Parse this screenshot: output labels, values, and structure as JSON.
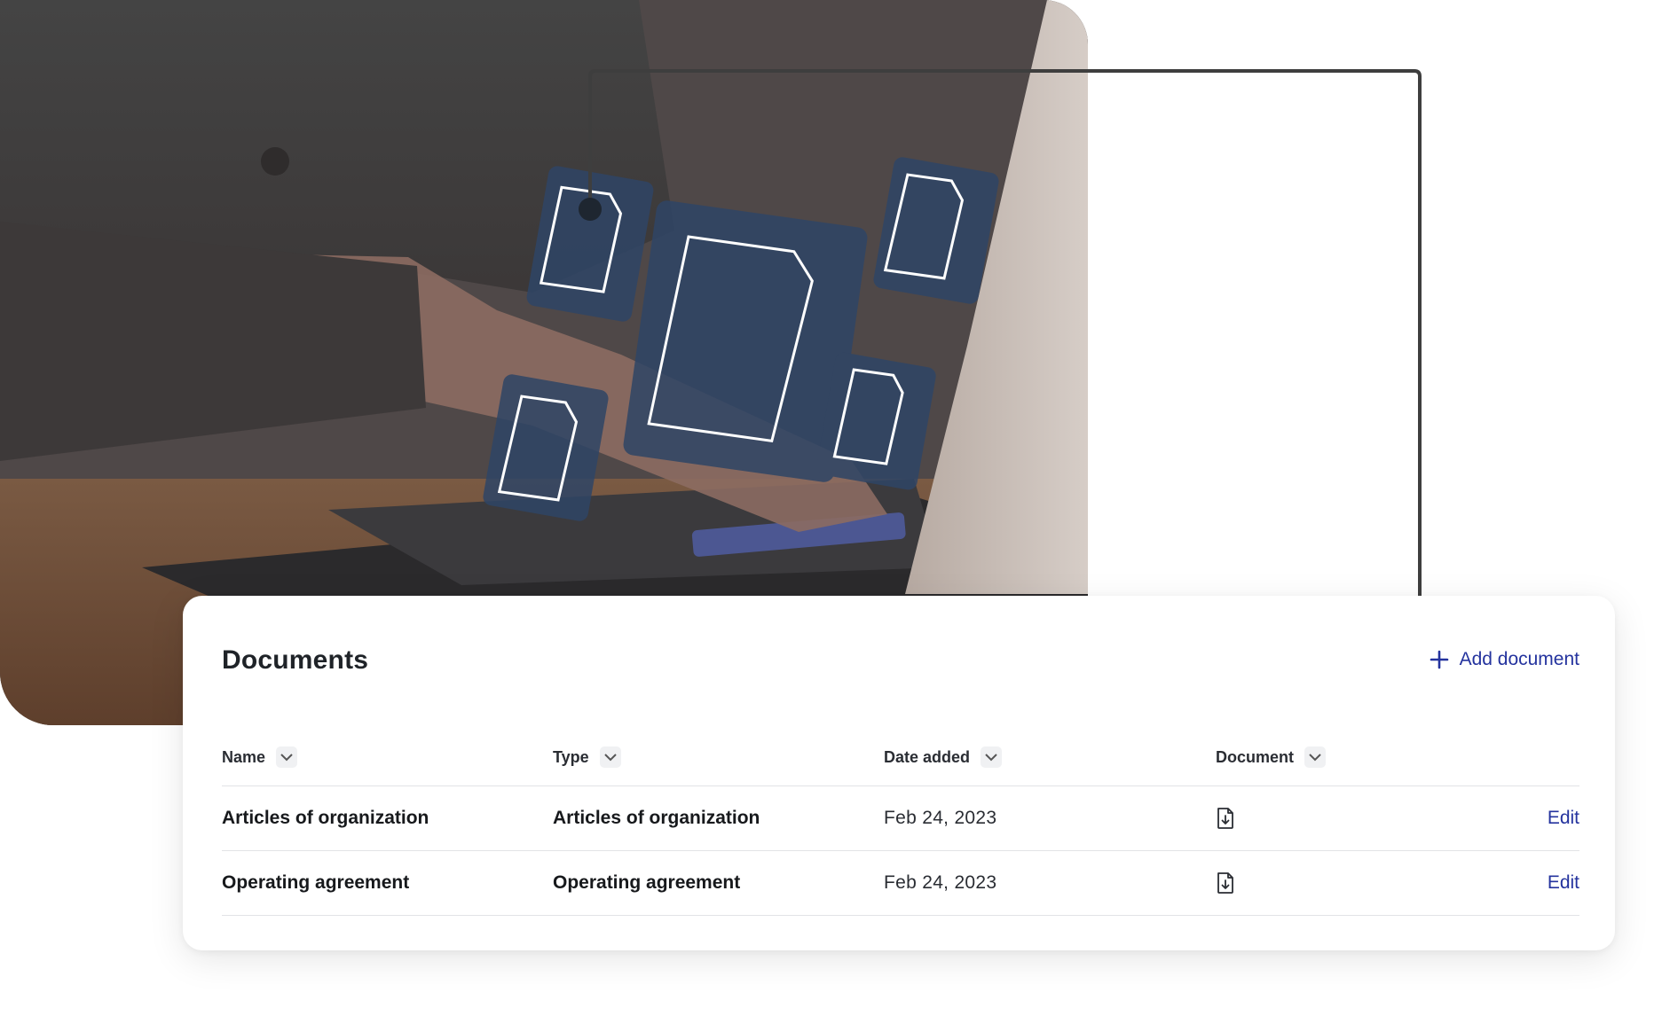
{
  "card": {
    "title": "Documents",
    "add_label": "Add document",
    "add_icon": "plus-icon",
    "accent": "#24339e"
  },
  "table": {
    "columns": [
      {
        "label": "Name",
        "sort_icon": "chevron-down-icon"
      },
      {
        "label": "Type",
        "sort_icon": "chevron-down-icon"
      },
      {
        "label": "Date added",
        "sort_icon": "chevron-down-icon"
      },
      {
        "label": "Document",
        "sort_icon": "chevron-down-icon"
      }
    ],
    "rows": [
      {
        "name": "Articles of organization",
        "type": "Articles of organization",
        "date": "Feb 24, 2023",
        "document_icon": "file-download-icon",
        "action": "Edit"
      },
      {
        "name": "Operating agreement",
        "type": "Operating agreement",
        "date": "Feb 24, 2023",
        "document_icon": "file-download-icon",
        "action": "Edit"
      }
    ]
  },
  "hero": {
    "image": "person typing on laptop with floating document icons"
  }
}
